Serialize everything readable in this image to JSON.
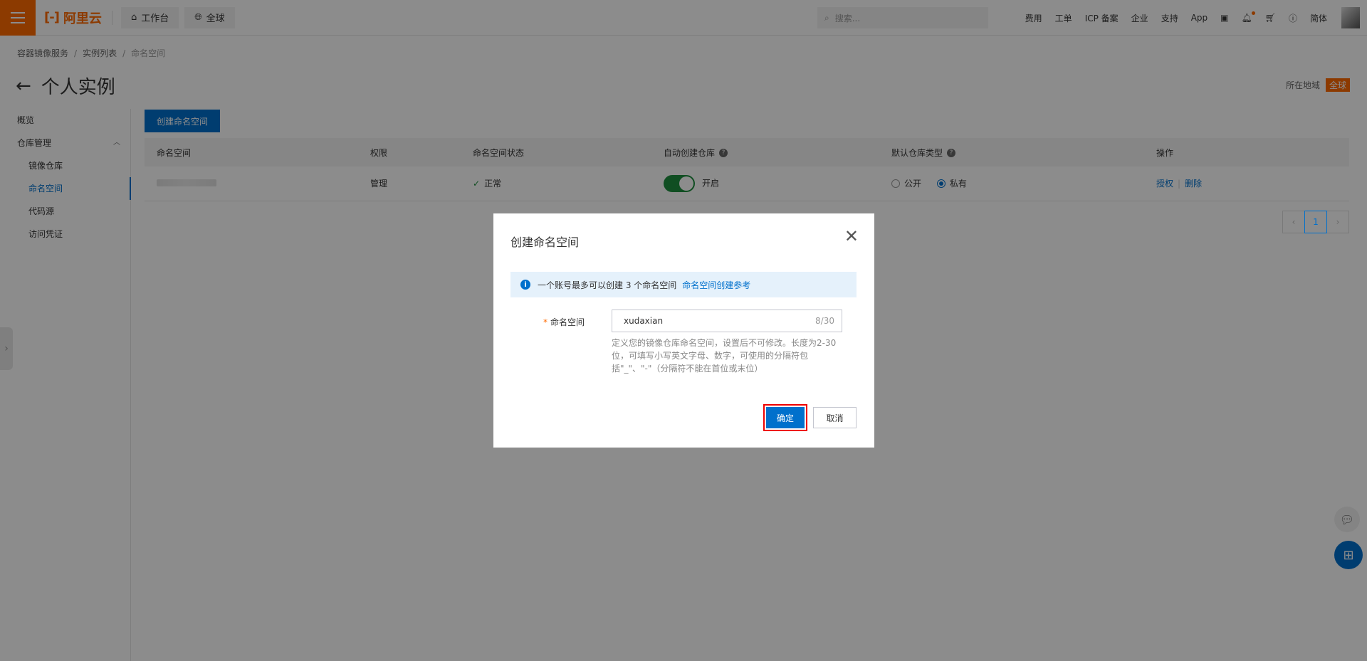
{
  "topbar": {
    "brand": "阿里云",
    "brand_mark": "[-]",
    "workbench": "工作台",
    "region_scope": "全球",
    "search_placeholder": "搜索...",
    "links": [
      "费用",
      "工单",
      "ICP 备案",
      "企业",
      "支持",
      "App"
    ],
    "language": "简体"
  },
  "breadcrumb": [
    "容器镜像服务",
    "实例列表",
    "命名空间"
  ],
  "page": {
    "title": "个人实例",
    "region_label": "所在地域",
    "region_value": "全球"
  },
  "sidebar": {
    "items": [
      {
        "label": "概览"
      },
      {
        "label": "仓库管理"
      },
      {
        "label": "镜像仓库"
      },
      {
        "label": "命名空间"
      },
      {
        "label": "代码源"
      },
      {
        "label": "访问凭证"
      }
    ]
  },
  "main": {
    "create_button": "创建命名空间",
    "table": {
      "headers": [
        "命名空间",
        "权限",
        "命名空间状态",
        "自动创建仓库",
        "默认仓库类型",
        "操作"
      ],
      "row": {
        "permission": "管理",
        "status": "正常",
        "auto_create": "开启",
        "repo_type_public": "公开",
        "repo_type_private": "私有",
        "action_authorize": "授权",
        "action_delete": "删除"
      }
    },
    "pagination": {
      "current": "1"
    }
  },
  "modal": {
    "title": "创建命名空间",
    "alert_text": "一个账号最多可以创建 3 个命名空间",
    "alert_link": "命名空间创建参考",
    "field_label": "命名空间",
    "field_value": "xudaxian",
    "field_count": "8/30",
    "field_help": "定义您的镜像仓库命名空间，设置后不可修改。长度为2-30位，可填写小写英文字母、数字，可使用的分隔符包括\"_\"、\"-\"（分隔符不能在首位或末位）",
    "ok": "确定",
    "cancel": "取消"
  },
  "colors": {
    "brand": "#ff6a00",
    "primary": "#0070cc",
    "success": "#1e8e3e"
  }
}
